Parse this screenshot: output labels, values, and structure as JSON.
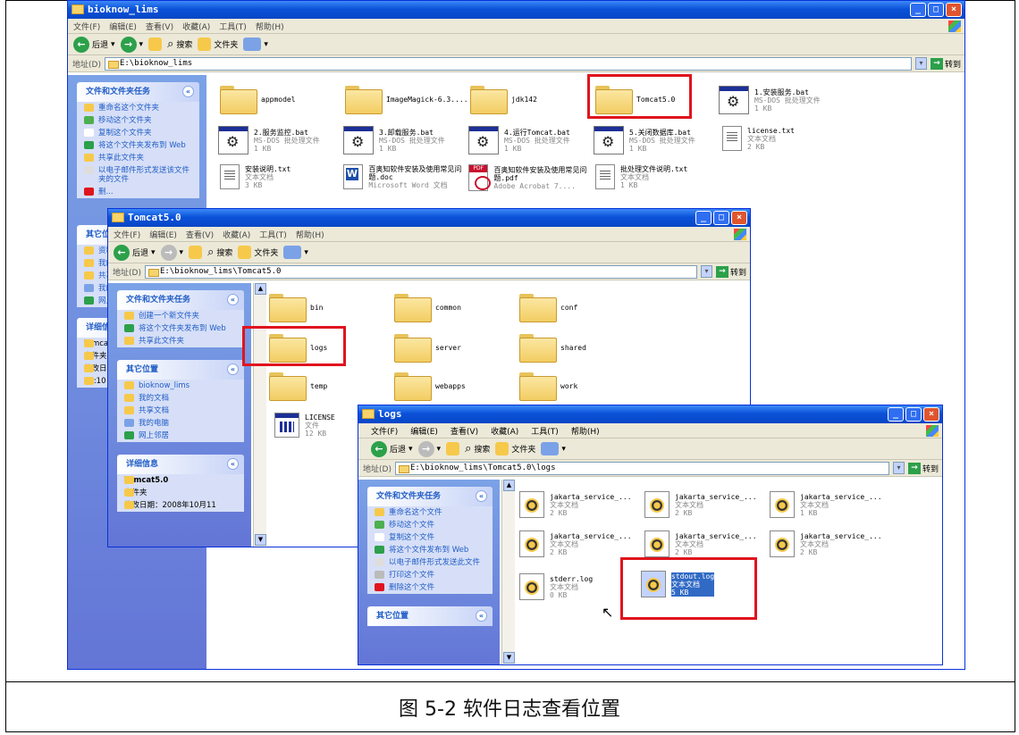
{
  "caption": "图 5-2 软件日志查看位置",
  "w1": {
    "title": "bioknow_lims",
    "menu": [
      "文件(F)",
      "编辑(E)",
      "查看(V)",
      "收藏(A)",
      "工具(T)",
      "帮助(H)"
    ],
    "back": "后退",
    "search": "搜索",
    "folders": "文件夹",
    "addr_label": "地址(D)",
    "address": "E:\\bioknow_lims",
    "go": "转到",
    "tasks_title": "文件和文件夹任务",
    "tasks": [
      "重命名这个文件夹",
      "移动这个文件夹",
      "复制这个文件夹",
      "将这个文件夹发布到 Web",
      "共享此文件夹",
      "以电子邮件形式发送该文件夹的文件",
      "删..."
    ],
    "other_title": "其它位",
    "other": [
      "资料",
      "我的",
      "共享",
      "我的",
      "网上"
    ],
    "detail_title": "详细信",
    "detail": [
      "Tomcat",
      "文件夹",
      "修改日期",
      "10:10"
    ],
    "items": [
      {
        "name": "appmodel",
        "type": "folder"
      },
      {
        "name": "ImageMagick-6.3....",
        "type": "folder"
      },
      {
        "name": "jdk142",
        "type": "folder"
      },
      {
        "name": "Tomcat5.0",
        "type": "folder"
      },
      {
        "name": "1.安装服务.bat",
        "sub": "MS-DOS 批处理文件",
        "size": "1 KB",
        "type": "bat"
      },
      {
        "name": "2.服务监控.bat",
        "sub": "MS-DOS 批处理文件",
        "size": "1 KB",
        "type": "bat"
      },
      {
        "name": "3.卸载服务.bat",
        "sub": "MS-DOS 批处理文件",
        "size": "1 KB",
        "type": "bat"
      },
      {
        "name": "4.运行Tomcat.bat",
        "sub": "MS-DOS 批处理文件",
        "size": "1 KB",
        "type": "bat"
      },
      {
        "name": "5.关闭数据库.bat",
        "sub": "MS-DOS 批处理文件",
        "size": "1 KB",
        "type": "bat"
      },
      {
        "name": "license.txt",
        "sub": "文本文档",
        "size": "2 KB",
        "type": "txt"
      },
      {
        "name": "安装说明.txt",
        "sub": "文本文档",
        "size": "3 KB",
        "type": "txt"
      },
      {
        "name": "百奥知软件安装及使用常见问题.doc",
        "sub": "Microsoft Word 文档",
        "type": "word"
      },
      {
        "name": "百奥知软件安装及使用常见问题.pdf",
        "sub": "Adobe Acrobat 7....",
        "type": "pdf"
      },
      {
        "name": "批处理文件说明.txt",
        "sub": "文本文档",
        "size": "1 KB",
        "type": "txt"
      }
    ]
  },
  "w2": {
    "title": "Tomcat5.0",
    "menu": [
      "文件(F)",
      "编辑(E)",
      "查看(V)",
      "收藏(A)",
      "工具(T)",
      "帮助(H)"
    ],
    "back": "后退",
    "search": "搜索",
    "folders": "文件夹",
    "addr_label": "地址(D)",
    "address": "E:\\bioknow_lims\\Tomcat5.0",
    "go": "转到",
    "tasks_title": "文件和文件夹任务",
    "tasks": [
      "创建一个新文件夹",
      "将这个文件夹发布到 Web",
      "共享此文件夹"
    ],
    "other_title": "其它位置",
    "other": [
      "bioknow_lims",
      "我的文档",
      "共享文档",
      "我的电脑",
      "网上邻居"
    ],
    "detail_title": "详细信息",
    "detail": [
      "Tomcat5.0",
      "文件夹",
      "修改日期：2008年10月11"
    ],
    "items": [
      {
        "name": "bin",
        "type": "folder"
      },
      {
        "name": "common",
        "type": "folder"
      },
      {
        "name": "conf",
        "type": "folder"
      },
      {
        "name": "logs",
        "type": "folder"
      },
      {
        "name": "server",
        "type": "folder"
      },
      {
        "name": "shared",
        "type": "folder"
      },
      {
        "name": "temp",
        "type": "folder"
      },
      {
        "name": "webapps",
        "type": "folder"
      },
      {
        "name": "work",
        "type": "folder"
      },
      {
        "name": "LICENSE",
        "sub": "文件",
        "size": "12 KB",
        "type": "lic"
      }
    ]
  },
  "w3": {
    "title": "logs",
    "menu": [
      "文件(F)",
      "编辑(E)",
      "查看(V)",
      "收藏(A)",
      "工具(T)",
      "帮助(H)"
    ],
    "back": "后退",
    "search": "搜索",
    "folders": "文件夹",
    "addr_label": "地址(D)",
    "address": "E:\\bioknow_lims\\Tomcat5.0\\logs",
    "go": "转到",
    "tasks_title": "文件和文件夹任务",
    "tasks": [
      "重命名这个文件",
      "移动这个文件",
      "复制这个文件",
      "将这个文件发布到 Web",
      "以电子邮件形式发送此文件",
      "打印这个文件",
      "删除这个文件"
    ],
    "other_title": "其它位置",
    "items": [
      {
        "name": "jakarta_service_...",
        "sub": "文本文档",
        "size": "2 KB"
      },
      {
        "name": "jakarta_service_...",
        "sub": "文本文档",
        "size": "2 KB"
      },
      {
        "name": "jakarta_service_...",
        "sub": "文本文档",
        "size": "1 KB"
      },
      {
        "name": "jakarta_service_...",
        "sub": "文本文档",
        "size": "2 KB"
      },
      {
        "name": "jakarta_service_...",
        "sub": "文本文档",
        "size": "2 KB"
      },
      {
        "name": "jakarta_service_...",
        "sub": "文本文档",
        "size": "2 KB"
      },
      {
        "name": "stderr.log",
        "sub": "文本文档",
        "size": "0 KB"
      },
      {
        "name": "stdout.log",
        "sub": "文本文档",
        "size": "5 KB"
      }
    ]
  }
}
